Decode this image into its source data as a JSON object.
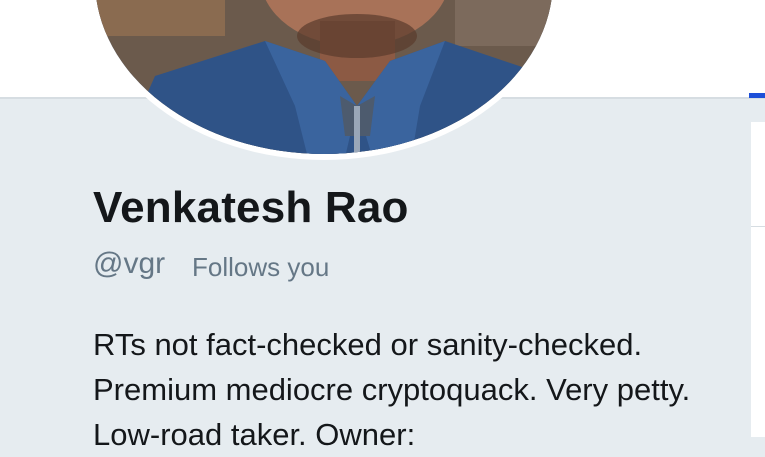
{
  "profile": {
    "name": "Venkatesh Rao",
    "handle": "@vgr",
    "follows_you": "Follows you",
    "bio": "RTs not fact-checked or sanity-checked. Premium mediocre cryptoquack. Very petty. Low-road taker. Owner:"
  },
  "colors": {
    "background": "#e6ecf0",
    "header": "#ffffff",
    "accent": "#1d4fd8",
    "text_primary": "#14171a",
    "text_secondary": "#657786"
  }
}
